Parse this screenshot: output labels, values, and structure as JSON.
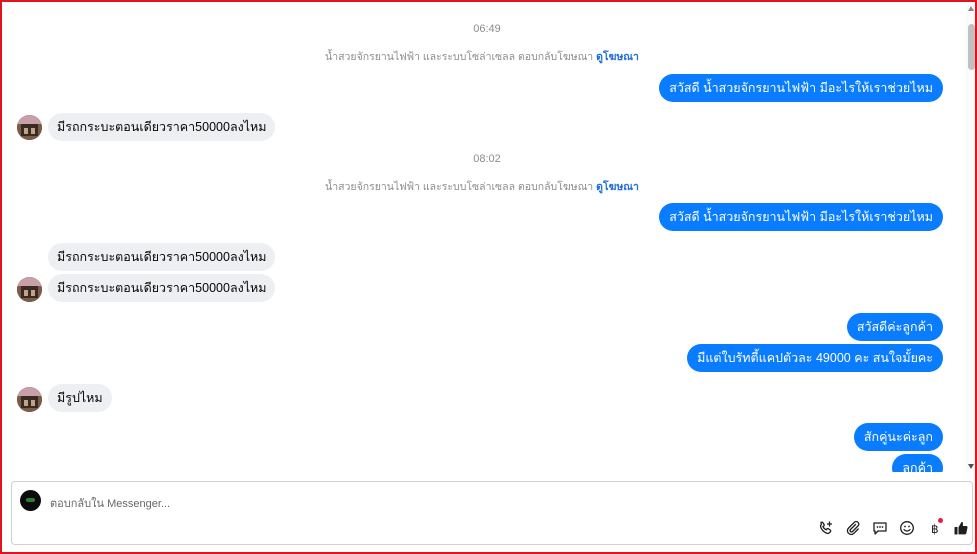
{
  "messages_view": {
    "timestamp_1": "06:49",
    "ad_reply_text_1": "น้ำสวยจักรยานไฟฟ้า และระบบโซล่าเซลล ตอบกลับโฆษณา",
    "ad_link_1": "ดูโฆษณา",
    "out_1": "สวัสดี น้ำสวยจักรยานไฟฟ้า มีอะไรให้เราช่วยไหม",
    "in_1": "มีรถกระบะตอนเดียวราคา50000ลงไหม",
    "timestamp_2": "08:02",
    "ad_reply_text_2": "น้ำสวยจักรยานไฟฟ้า และระบบโซล่าเซลล ตอบกลับโฆษณา",
    "ad_link_2": "ดูโฆษณา",
    "out_2": "สวัสดี น้ำสวยจักรยานไฟฟ้า มีอะไรให้เราช่วยไหม",
    "in_2": "มีรถกระบะตอนเดียวราคา50000ลงไหม",
    "in_3": "มีรถกระบะตอนเดียวราคา50000ลงไหม",
    "out_3": "สวัสดีค่ะลูกค้า",
    "out_4": "มีแต่ใบรัทตี้แคปตัวละ 49000 คะ สนใจมั้ยคะ",
    "in_4": "มีรูปไหม",
    "out_5": "สักคู่นะค่ะลูก",
    "out_6": "ลูกค้า"
  },
  "composer": {
    "placeholder": "ตอบกลับใน Messenger...",
    "icons": [
      "add-call-icon",
      "attachment-icon",
      "saved-reply-icon",
      "emoji-icon",
      "baht-payment-icon",
      "thumbs-up-icon"
    ]
  },
  "colors": {
    "outgoing_bubble": "#0a7cff",
    "incoming_bubble": "#eeeff2",
    "border": "#e0141e",
    "link": "#216fdb"
  }
}
